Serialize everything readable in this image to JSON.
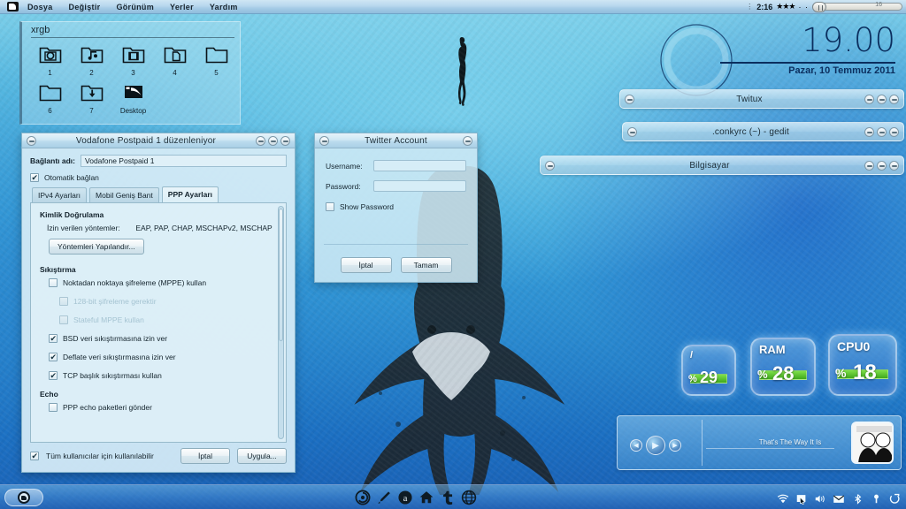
{
  "top_panel": {
    "logo_icon": "window-logo-icon",
    "menus": [
      "Dosya",
      "Değiştir",
      "Görünüm",
      "Yerler",
      "Yardım"
    ],
    "clock": "2:16",
    "stars": "★★★",
    "dots": "· ·",
    "slider_value": "16"
  },
  "xrgb": {
    "title": "xrgb",
    "icons": [
      {
        "label": "1",
        "icon": "folder-pictures-icon"
      },
      {
        "label": "2",
        "icon": "folder-music-icon"
      },
      {
        "label": "3",
        "icon": "folder-videos-icon"
      },
      {
        "label": "4",
        "icon": "folder-documents-icon"
      },
      {
        "label": "5",
        "icon": "folder-icon"
      },
      {
        "label": "6",
        "icon": "folder-icon"
      },
      {
        "label": "7",
        "icon": "folder-downloads-icon"
      },
      {
        "label": "Desktop",
        "icon": "desktop-icon"
      }
    ]
  },
  "vodafone_dialog": {
    "title": "Vodafone Postpaid 1 düzenleniyor",
    "connection_name_label": "Bağlantı adı:",
    "connection_name_value": "Vodafone Postpaid 1",
    "auto_connect_label": "Otomatik bağlan",
    "auto_connect_checked": true,
    "tabs": [
      {
        "label": "IPv4 Ayarları",
        "active": false
      },
      {
        "label": "Mobil Geniş Bant",
        "active": false
      },
      {
        "label": "PPP Ayarları",
        "active": true
      }
    ],
    "auth_section": "Kimlik Doğrulama",
    "methods_label": "İzin verilen yöntemler:",
    "methods_value": "EAP, PAP, CHAP, MSCHAPv2, MSCHAP",
    "configure_button": "Yöntemleri Yapılandır...",
    "compression_section": "Sıkıştırma",
    "compression_options": [
      {
        "label": "Noktadan noktaya şifreleme (MPPE) kullan",
        "checked": false,
        "disabled": false
      },
      {
        "label": "128-bit şifreleme gerektir",
        "checked": false,
        "disabled": true
      },
      {
        "label": "Stateful MPPE kullan",
        "checked": false,
        "disabled": true
      },
      {
        "label": "BSD veri sıkıştırmasına izin ver",
        "checked": true,
        "disabled": false
      },
      {
        "label": "Deflate veri sıkıştırmasına izin ver",
        "checked": true,
        "disabled": false
      },
      {
        "label": "TCP başlık sıkıştırması kullan",
        "checked": true,
        "disabled": false
      }
    ],
    "echo_section": "Echo",
    "echo_option": {
      "label": "PPP echo paketleri gönder",
      "checked": false
    },
    "all_users_label": "Tüm kullanıcılar için kullanılabilir",
    "all_users_checked": true,
    "cancel_button": "İptal",
    "apply_button": "Uygula..."
  },
  "twitter_dialog": {
    "title": "Twitter Account",
    "username_label": "Username:",
    "username_value": "",
    "password_label": "Password:",
    "password_value": "",
    "show_password_label": "Show Password",
    "show_password_checked": false,
    "cancel_button": "İptal",
    "ok_button": "Tamam"
  },
  "conky_clock": {
    "time": "19.00",
    "date": "Pazar, 10 Temmuz 2011"
  },
  "shaded_windows": [
    {
      "title": "Twitux"
    },
    {
      "title": ".conkyrc (~) - gedit"
    },
    {
      "title": "Bilgisayar"
    }
  ],
  "monitors": [
    {
      "name": "/",
      "percent_sign": "%",
      "value": "29"
    },
    {
      "name": "RAM",
      "percent_sign": "%",
      "value": "28"
    },
    {
      "name": "CPU0",
      "percent_sign": "%",
      "value": "18"
    }
  ],
  "media_player": {
    "track": "That's The Way It Is",
    "prev_icon": "previous-track-icon",
    "play_icon": "play-icon",
    "next_icon": "next-track-icon",
    "album_art_icon": "album-art-icon"
  },
  "bottom_panel": {
    "start_icon": "start-menu-icon",
    "dock_icons": [
      "chromium-icon",
      "pencil-icon",
      "amazon-icon",
      "home-icon",
      "twitter-icon",
      "globe-icon"
    ],
    "tray_icons": [
      "wifi-icon",
      "network-icon",
      "volume-icon",
      "mail-icon",
      "bluetooth-icon",
      "key-icon",
      "logout-icon"
    ]
  },
  "colors": {
    "accent": "#0b2e5e",
    "monitor_bar": "#4eb823",
    "panel": "#a6cbe6"
  }
}
